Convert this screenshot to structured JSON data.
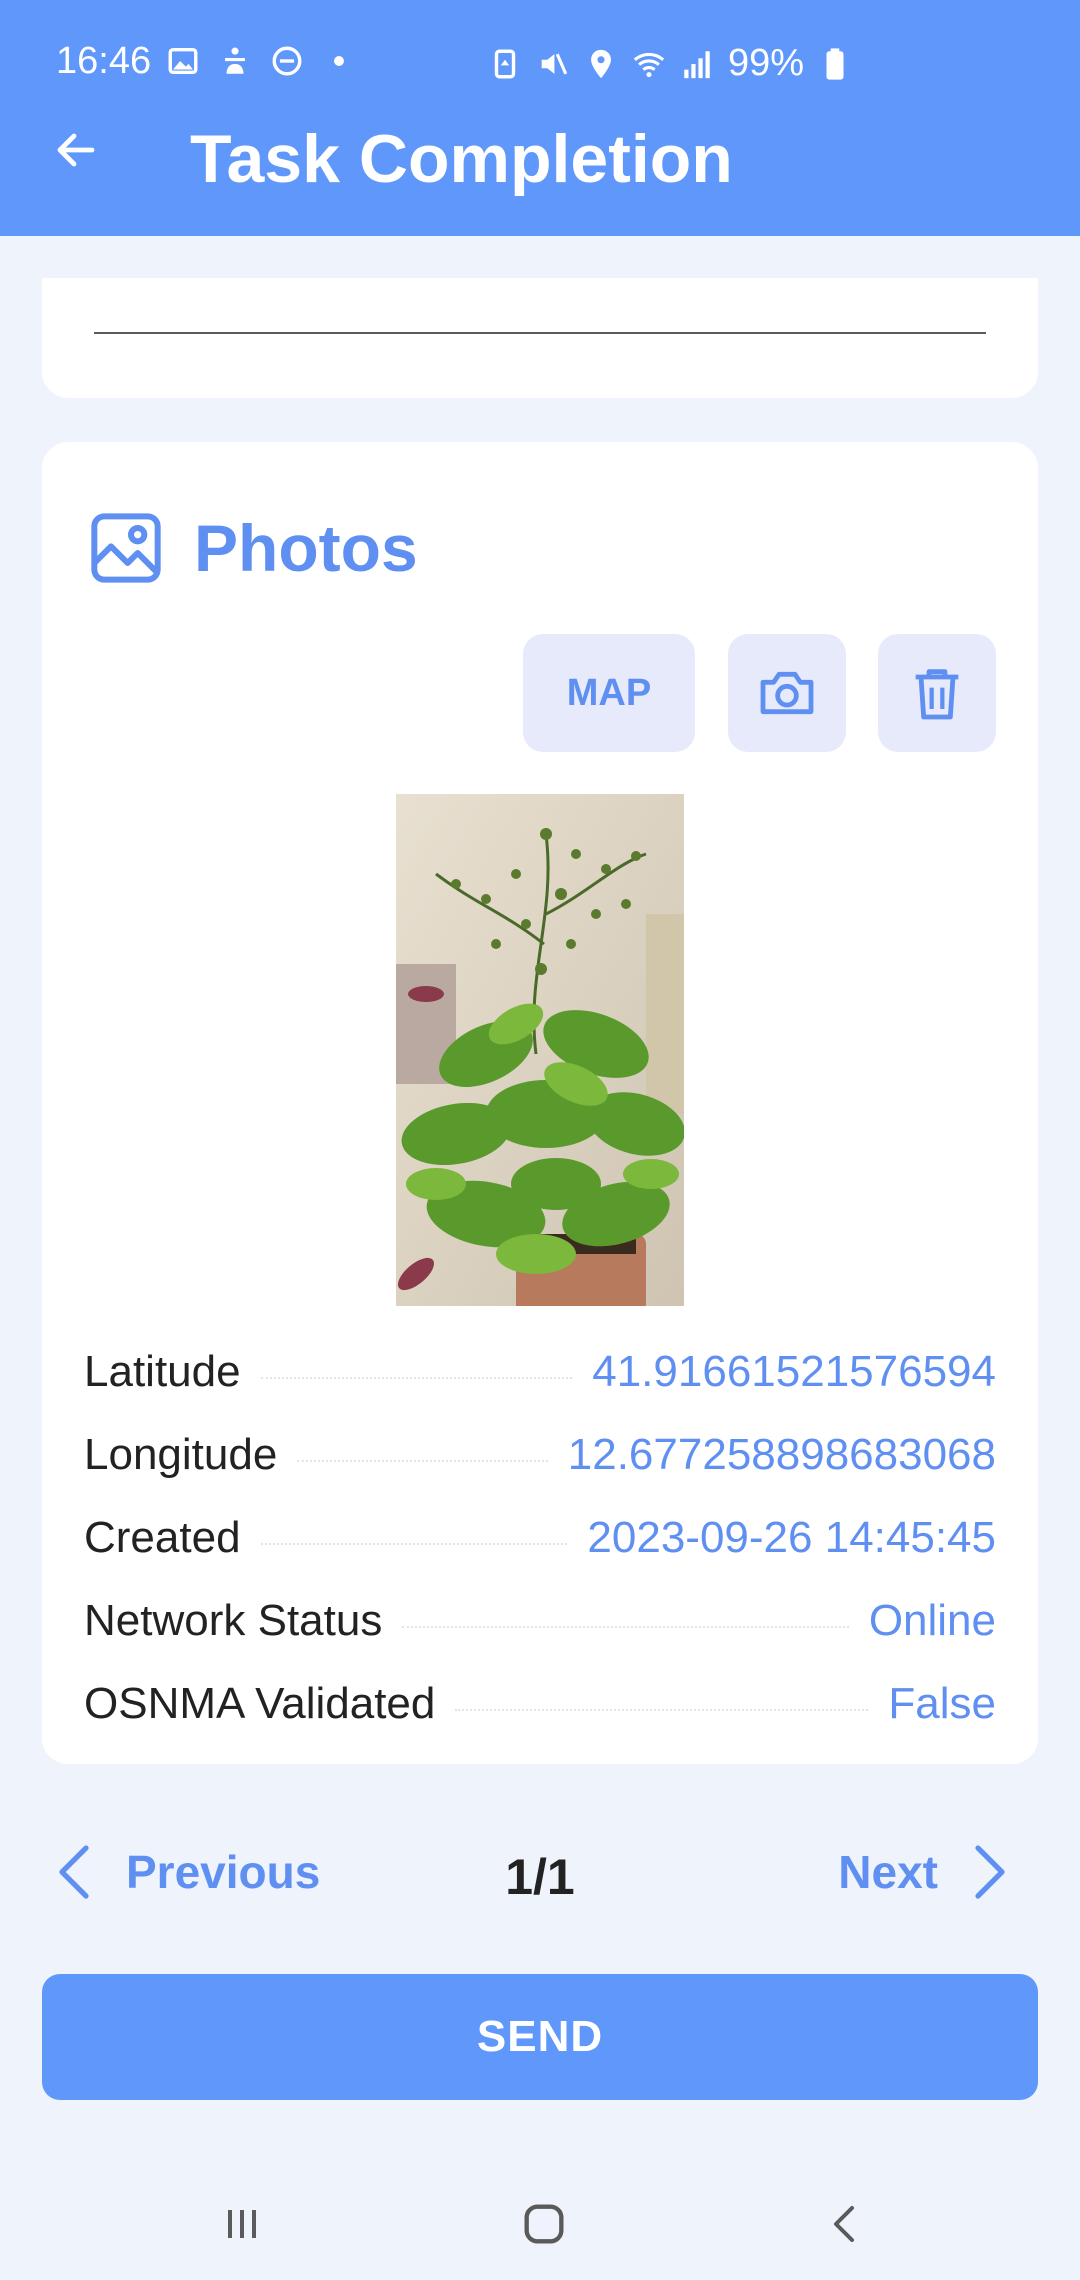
{
  "status_bar": {
    "time": "16:46",
    "battery": "99%"
  },
  "header": {
    "title": "Task Completion"
  },
  "photos": {
    "title": "Photos",
    "map_label": "MAP",
    "metadata": [
      {
        "label": "Latitude",
        "value": "41.91661521576594"
      },
      {
        "label": "Longitude",
        "value": "12.677258898683068"
      },
      {
        "label": "Created",
        "value": "2023-09-26 14:45:45"
      },
      {
        "label": "Network Status",
        "value": "Online"
      },
      {
        "label": "OSNMA Validated",
        "value": "False"
      }
    ]
  },
  "pager": {
    "previous_label": "Previous",
    "next_label": "Next",
    "page_count": "1/1"
  },
  "send_label": "SEND",
  "colors": {
    "primary": "#5f97fa",
    "accent_text": "#5f8ff1",
    "button_bg": "#e7eafb",
    "background": "#eff3fb"
  }
}
